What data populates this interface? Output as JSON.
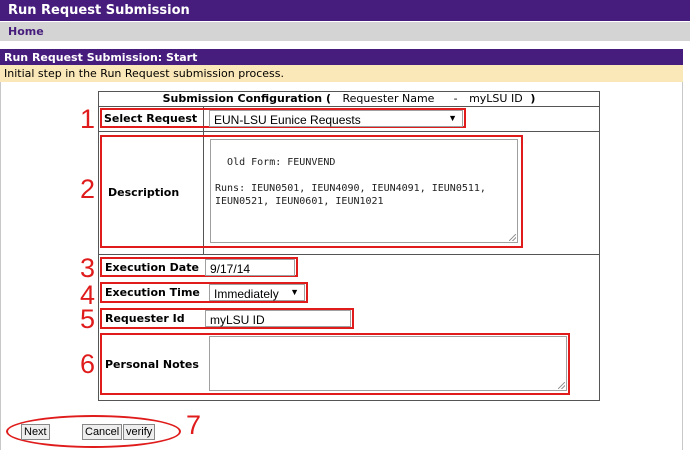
{
  "header": {
    "title": "Run Request Submission"
  },
  "nav": {
    "home": "Home"
  },
  "section": {
    "title": "Run Request Submission: Start",
    "description": "Initial step in the Run Request submission process."
  },
  "config": {
    "title_prefix": "Submission Configuration (",
    "requester_name": "Requester Name",
    "separator": "-",
    "requester_id_label": "myLSU ID",
    "title_suffix": ")"
  },
  "form": {
    "select_request": {
      "label": "Select Request",
      "value": "EUN-LSU Eunice Requests"
    },
    "description": {
      "label": "Description",
      "value": "Old Form: FEUNVEND\n\nRuns: IEUN0501, IEUN4090, IEUN4091, IEUN0511,\nIEUN0521, IEUN0601, IEUN1021"
    },
    "execution_date": {
      "label": "Execution Date",
      "value": "9/17/14"
    },
    "execution_time": {
      "label": "Execution Time",
      "value": "Immediately"
    },
    "requester_id": {
      "label": "Requester Id",
      "value": "myLSU ID"
    },
    "personal_notes": {
      "label": "Personal Notes",
      "value": ""
    }
  },
  "buttons": {
    "next": "Next",
    "cancel": "Cancel",
    "verify": "verify"
  },
  "annotations": [
    "1",
    "2",
    "3",
    "4",
    "5",
    "6",
    "7"
  ],
  "colors": {
    "brand": "#461d7c",
    "highlight": "#e01b1b",
    "notice": "#fbe8b8"
  },
  "icons": {
    "dropdown": "triangle-down-icon",
    "resize": "resize-handle-icon"
  }
}
